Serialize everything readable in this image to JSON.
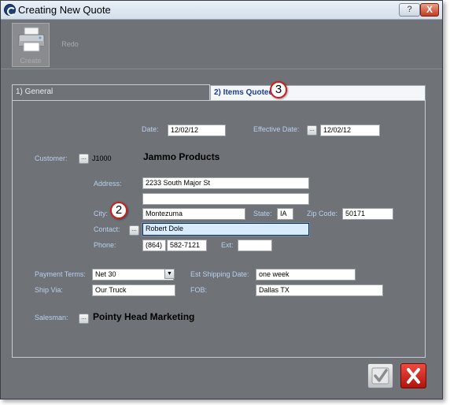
{
  "window": {
    "title": "Creating New Quote",
    "help_label": "?",
    "close_label": "X"
  },
  "toolbar": {
    "create_label": "Create",
    "redo_label": "Redo"
  },
  "tabs": [
    {
      "label": "1) General"
    },
    {
      "label": "2) Items Quoted"
    }
  ],
  "callouts": [
    "2",
    "3"
  ],
  "form": {
    "date_label": "Date:",
    "date_value": "12/02/12",
    "effective_date_label": "Effective Date:",
    "effective_date_value": "12/02/12",
    "customer_label": "Customer:",
    "customer_code": "J1000",
    "customer_name": "Jammo Products",
    "address_label": "Address:",
    "address_line1": "2233 South Major St",
    "address_line2": "",
    "city_label": "City:",
    "city_value": "Montezuma",
    "state_label": "State:",
    "state_value": "IA",
    "zip_label": "Zip Code:",
    "zip_value": "50171",
    "contact_label": "Contact:",
    "contact_value": "Robert Dole",
    "phone_label": "Phone:",
    "phone_area": "(864)",
    "phone_number": "582-7121",
    "ext_label": "Ext:",
    "ext_value": "",
    "payment_terms_label": "Payment Terms:",
    "payment_terms_value": "Net 30",
    "est_shipping_label": "Est Shipping Date:",
    "est_shipping_value": "one week",
    "ship_via_label": "Ship Via:",
    "ship_via_value": "Our Truck",
    "fob_label": "FOB:",
    "fob_value": "Dallas TX",
    "salesman_label": "Salesman:",
    "salesman_name": "Pointy Head Marketing",
    "lookup_button_label": "..."
  },
  "colors": {
    "background": "#6f7276",
    "label": "#b9d0ef",
    "active_field": "#d8ecff",
    "callout_border": "#d21c1c",
    "ok_button": "#bfc2c5",
    "cancel_button": "#b1140c"
  },
  "icons": {
    "app": "app-icon",
    "create": "printer-icon",
    "ok": "checkmark-icon",
    "cancel": "x-icon",
    "payment_combo": "chevron-down-icon"
  }
}
